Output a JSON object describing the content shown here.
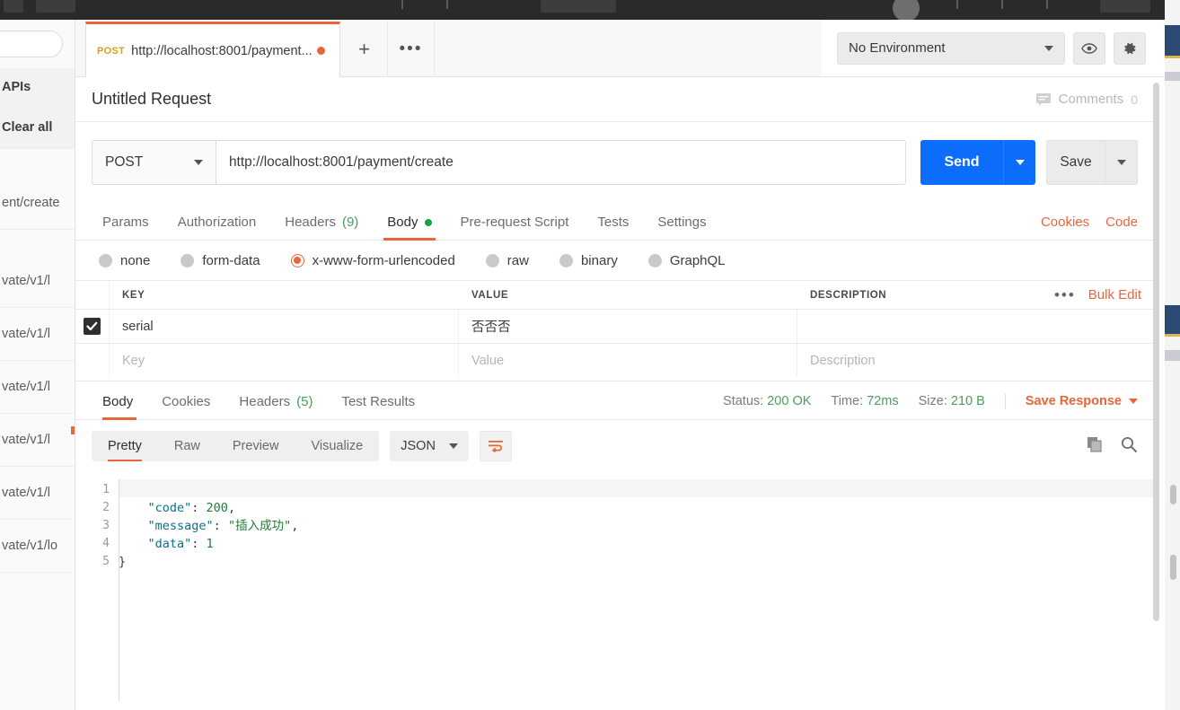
{
  "window": {
    "top_strip_color": "#2a2a2a"
  },
  "sidebar": {
    "search_placeholder": "",
    "items": [
      {
        "label": "APIs",
        "header": true
      },
      {
        "label": "Clear all",
        "header": true
      },
      {
        "label": "ent/create",
        "header": false
      },
      {
        "label": "vate/v1/l",
        "header": false
      },
      {
        "label": "vate/v1/l",
        "header": false
      },
      {
        "label": "vate/v1/l",
        "header": false
      },
      {
        "label": "vate/v1/l",
        "header": false
      },
      {
        "label": "vate/v1/l",
        "header": false
      },
      {
        "label": "vate/v1/lo",
        "header": false
      }
    ]
  },
  "tabstrip": {
    "tab": {
      "method": "POST",
      "url": "http://localhost:8001/payment...",
      "unsaved": true
    },
    "new_tab_icon": "plus-icon",
    "more_icon": "ellipsis-icon"
  },
  "environment": {
    "selected": "No Environment",
    "eye_icon": "eye-icon",
    "settings_icon": "gear-icon"
  },
  "request": {
    "title": "Untitled Request",
    "comments_label": "Comments",
    "comments_count": "0",
    "method": "POST",
    "url": "http://localhost:8001/payment/create",
    "send_label": "Send",
    "save_label": "Save",
    "tabs": [
      {
        "label": "Params",
        "count": "",
        "dot": false,
        "active": false
      },
      {
        "label": "Authorization",
        "count": "",
        "dot": false,
        "active": false
      },
      {
        "label": "Headers",
        "count": "(9)",
        "dot": false,
        "active": false
      },
      {
        "label": "Body",
        "count": "",
        "dot": true,
        "active": true
      },
      {
        "label": "Pre-request Script",
        "count": "",
        "dot": false,
        "active": false
      },
      {
        "label": "Tests",
        "count": "",
        "dot": false,
        "active": false
      },
      {
        "label": "Settings",
        "count": "",
        "dot": false,
        "active": false
      }
    ],
    "right_links": [
      {
        "label": "Cookies"
      },
      {
        "label": "Code"
      }
    ]
  },
  "body_types": [
    {
      "label": "none",
      "selected": false
    },
    {
      "label": "form-data",
      "selected": false
    },
    {
      "label": "x-www-form-urlencoded",
      "selected": true
    },
    {
      "label": "raw",
      "selected": false
    },
    {
      "label": "binary",
      "selected": false
    },
    {
      "label": "GraphQL",
      "selected": false
    }
  ],
  "kv_table": {
    "headers": {
      "key": "KEY",
      "value": "VALUE",
      "description": "DESCRIPTION"
    },
    "bulk_edit_label": "Bulk Edit",
    "more_icon": "ellipsis-icon",
    "rows": [
      {
        "checked": true,
        "key": "serial",
        "value": "否否否",
        "description": "",
        "placeholder": false
      }
    ],
    "placeholder_row": {
      "key": "Key",
      "value": "Value",
      "description": "Description"
    }
  },
  "response": {
    "tabs": [
      {
        "label": "Body",
        "count": "",
        "active": true
      },
      {
        "label": "Cookies",
        "count": "",
        "active": false
      },
      {
        "label": "Headers",
        "count": "(5)",
        "active": false
      },
      {
        "label": "Test Results",
        "count": "",
        "active": false
      }
    ],
    "status_label": "Status:",
    "status_value": "200 OK",
    "time_label": "Time:",
    "time_value": "72ms",
    "size_label": "Size:",
    "size_value": "210 B",
    "save_response_label": "Save Response",
    "formats": [
      {
        "label": "Pretty",
        "active": true
      },
      {
        "label": "Raw",
        "active": false
      },
      {
        "label": "Preview",
        "active": false
      },
      {
        "label": "Visualize",
        "active": false
      }
    ],
    "language": "JSON",
    "wrap_icon": "word-wrap-icon",
    "copy_icon": "copy-icon",
    "search_icon": "search-icon",
    "body_lines": [
      {
        "n": "1",
        "tokens": [
          {
            "t": "{",
            "c": "jp"
          }
        ]
      },
      {
        "n": "2",
        "tokens": [
          {
            "t": "    \"code\"",
            "c": "jk"
          },
          {
            "t": ": ",
            "c": "jp"
          },
          {
            "t": "200",
            "c": "jn"
          },
          {
            "t": ",",
            "c": "jp"
          }
        ]
      },
      {
        "n": "3",
        "tokens": [
          {
            "t": "    \"message\"",
            "c": "jk"
          },
          {
            "t": ": ",
            "c": "jp"
          },
          {
            "t": "\"插入成功\"",
            "c": "js"
          },
          {
            "t": ",",
            "c": "jp"
          }
        ]
      },
      {
        "n": "4",
        "tokens": [
          {
            "t": "    \"data\"",
            "c": "jk"
          },
          {
            "t": ": ",
            "c": "jp"
          },
          {
            "t": "1",
            "c": "jn"
          }
        ]
      },
      {
        "n": "5",
        "tokens": [
          {
            "t": "}",
            "c": "jp"
          }
        ]
      }
    ]
  },
  "colors": {
    "accent_orange": "#e8663a",
    "send_blue": "#0d6efd",
    "status_green": "#4a9d5b",
    "method_yellow": "#d9a21b"
  }
}
